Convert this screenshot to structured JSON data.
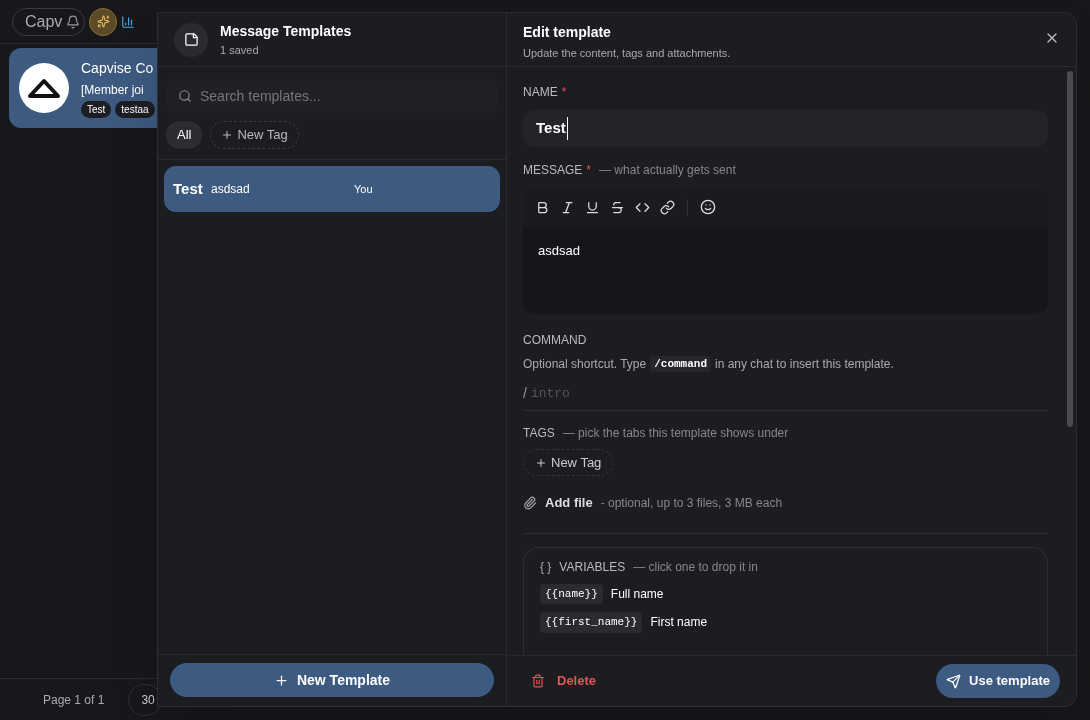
{
  "background": {
    "search_pill": {
      "text": "Capv"
    },
    "chat": {
      "title": "Capvise Co",
      "preview": "[Member joi",
      "tags": [
        "Test",
        "testaa"
      ],
      "selected": true
    },
    "pager": {
      "label": "Page 1 of 1",
      "page_size": "30"
    }
  },
  "templates_panel": {
    "title": "Message Templates",
    "subtitle": "1 saved",
    "search": {
      "placeholder": "Search templates..."
    },
    "filters": [
      {
        "label": "All",
        "kind": "chip",
        "selected": true
      },
      {
        "label": "New Tag",
        "kind": "add",
        "selected": false
      }
    ],
    "items": [
      {
        "name": "Test",
        "preview": "asdsad",
        "author": "You",
        "selected": true
      }
    ],
    "new_button": "New Template"
  },
  "editor": {
    "title": "Edit template",
    "subtitle": "Update the content, tags and attachments.",
    "name_field": {
      "label": "NAME",
      "required_mark": "*",
      "value": "Test"
    },
    "message_field": {
      "label": "MESSAGE",
      "required_mark": "*",
      "hint": "— what actually gets sent",
      "value": "asdsad"
    },
    "command": {
      "label": "COMMAND",
      "help_before": "Optional shortcut. Type",
      "help_code": "/command",
      "help_after": "in any chat to insert this template.",
      "prefix": "/",
      "placeholder": "intro"
    },
    "tags": {
      "label": "TAGS",
      "hint": "— pick the tabs this template shows under",
      "add_button": "New Tag"
    },
    "attach": {
      "label": "Add file",
      "hint": "- optional, up to 3 files, 3 MB each"
    },
    "variables": {
      "icon_text": "{ }",
      "label": "VARIABLES",
      "hint": "— click one to drop it in",
      "items": [
        {
          "token": "{{name}}",
          "label": "Full name"
        },
        {
          "token": "{{first_name}}",
          "label": "First name"
        }
      ]
    },
    "delete_button": "Delete",
    "use_button": "Use template"
  }
}
